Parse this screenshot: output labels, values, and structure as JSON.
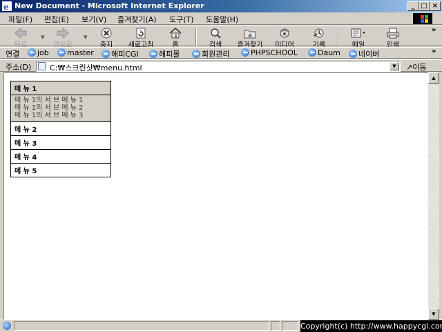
{
  "window": {
    "title": "New Document - Microsoft Internet Explorer"
  },
  "menubar": [
    "파일(F)",
    "편집(E)",
    "보기(V)",
    "즐겨찾기(A)",
    "도구(T)",
    "도움말(H)"
  ],
  "toolbar": {
    "back": "뒤로",
    "forward": "앞으로",
    "stop": "중지",
    "refresh": "새로고침",
    "home": "홈",
    "search": "검색",
    "favorites": "즐겨찾기",
    "media": "미디어",
    "history": "기록",
    "mail": "메일",
    "print": "인쇄"
  },
  "links": {
    "label": "연결",
    "items": [
      "job",
      "master",
      "해피CGI",
      "해피몰",
      "회원관리",
      "PHPSCHOOL",
      "Daum",
      "네이버"
    ]
  },
  "address": {
    "label": "주소(D)",
    "value": "C:₩스크린샷₩menu.html",
    "go": "이동"
  },
  "menu": {
    "header": "메 뉴 1",
    "submenu": [
      "메 뉴 1의  서 브 메 뉴 1",
      "메 뉴 1의  서 브 메 뉴 2",
      "메 뉴 1의  서 브 메 뉴 3"
    ],
    "items": [
      "메 뉴 2",
      "메 뉴 3",
      "메 뉴 4",
      "메 뉴 5"
    ]
  },
  "statusbar": {
    "copyright": "Copyright(c) http://www.happycgi.com"
  }
}
